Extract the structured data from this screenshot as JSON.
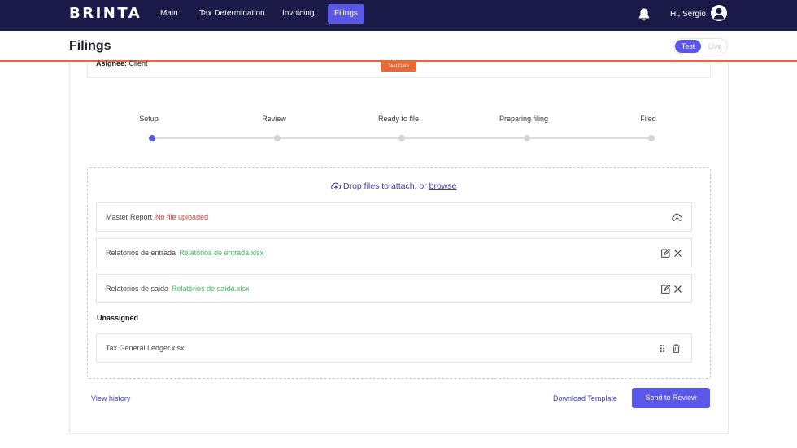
{
  "brand": {
    "logo_text": "BRINTA"
  },
  "nav": {
    "items": [
      {
        "label": "Main",
        "active": false
      },
      {
        "label": "Tax Determination",
        "active": false
      },
      {
        "label": "Invoicing",
        "active": false
      },
      {
        "label": "Filings",
        "active": true
      }
    ],
    "greeting": "Hi, Sergio"
  },
  "header": {
    "title": "Filings",
    "mode_toggle": {
      "options": [
        "Test",
        "Live"
      ],
      "selected": "Test"
    },
    "test_tag": "Test Data"
  },
  "assignee": {
    "label": "Asignee:",
    "value": "Client"
  },
  "stepper": {
    "steps": [
      "Setup",
      "Review",
      "Ready to file",
      "Preparing filing",
      "Filed"
    ],
    "current_index": 0
  },
  "dropzone": {
    "prompt": "Drop files to attach, or",
    "browse_label": "browse"
  },
  "files": [
    {
      "name": "Master Report",
      "status": "No file uploaded",
      "state": "missing"
    },
    {
      "name": "Relatorios de entrada",
      "status": "Relatórios de entrada.xlsx",
      "state": "uploaded"
    },
    {
      "name": "Relatorios de saida",
      "status": "Relatórios de saída.xlsx",
      "state": "uploaded"
    }
  ],
  "unassigned": {
    "heading": "Unassigned",
    "files": [
      {
        "name": "Tax General Ledger.xlsx"
      }
    ]
  },
  "footer": {
    "view_history": "View history",
    "download_template": "Download Template",
    "send_to_review": "Send to Review"
  },
  "colors": {
    "nav_bg": "#1b1a48",
    "accent": "#5b57e8",
    "orange": "#e56a35",
    "error": "#d63b32",
    "success": "#3fba64",
    "link": "#3b3ab0"
  },
  "icons": {
    "bell": "bell-icon",
    "avatar": "user-avatar-icon",
    "cloud_upload": "cloud-upload-icon",
    "edit": "edit-icon",
    "close": "close-icon",
    "drag": "drag-handle-icon",
    "trash": "trash-icon"
  }
}
